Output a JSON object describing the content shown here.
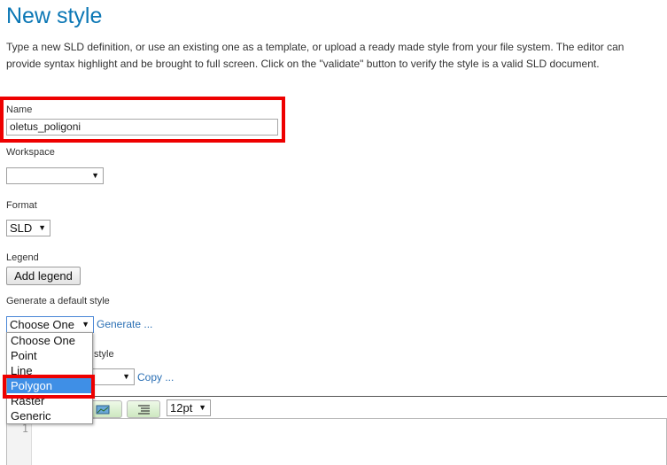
{
  "page": {
    "title": "New style",
    "description": "Type a new SLD definition, or use an existing one as a template, or upload a ready made style from your file system. The editor can provide syntax highlight and be brought to full screen. Click on the \"validate\" button to verify the style is a valid SLD document."
  },
  "form": {
    "name_label": "Name",
    "name_value": "oletus_poligoni",
    "workspace_label": "Workspace",
    "workspace_value": "",
    "format_label": "Format",
    "format_value": "SLD",
    "legend_label": "Legend",
    "add_legend_button": "Add legend",
    "generate_label": "Generate a default style",
    "generate_select_value": "Choose One",
    "generate_link": "Generate ...",
    "copy_label_partial": "style",
    "copy_link": "Copy ..."
  },
  "generate_dropdown": {
    "options": [
      "Choose One",
      "Point",
      "Line",
      "Polygon",
      "Raster",
      "Generic"
    ],
    "highlighted": "Polygon"
  },
  "editor": {
    "font_size": "12pt",
    "line_number": "1"
  },
  "colors": {
    "title": "#0b77b5",
    "highlight_box": "#ee0000",
    "selected_option": "#3f8fe6",
    "link": "#2a6fb4"
  },
  "icons": [
    "caret-down-icon",
    "image-insert-icon",
    "indent-icon"
  ]
}
